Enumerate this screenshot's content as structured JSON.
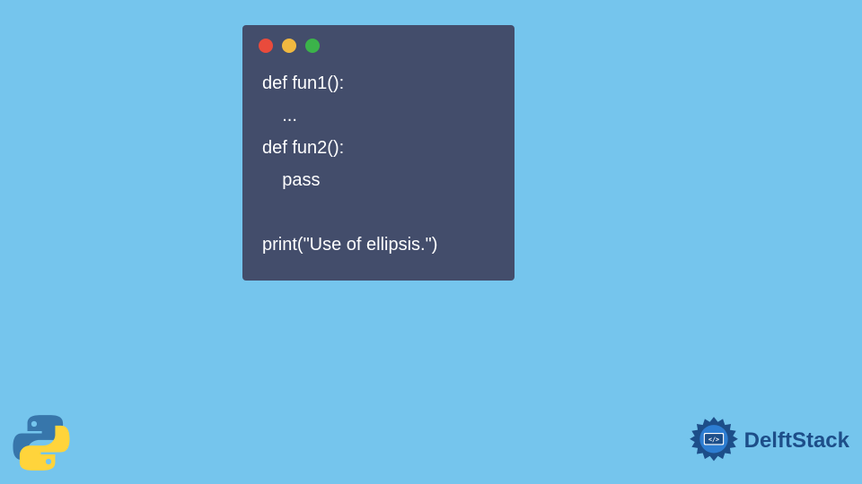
{
  "code": {
    "lines": [
      "def fun1():",
      "    ...",
      "def fun2():",
      "    pass",
      "",
      "print(\"Use of ellipsis.\")"
    ]
  },
  "brand": {
    "name": "DelftStack"
  },
  "colors": {
    "background": "#75c5ed",
    "window": "#434d6b",
    "brand_primary": "#1d4e89",
    "brand_accent": "#2d7dd2"
  }
}
